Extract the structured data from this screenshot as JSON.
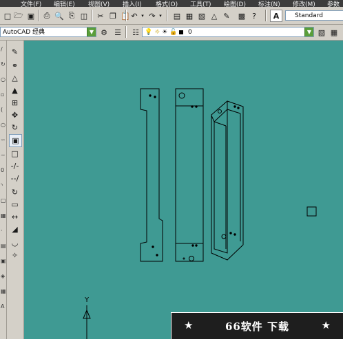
{
  "menu": {
    "items": [
      "文件(F)",
      "编辑(E)",
      "视图(V)",
      "插入(I)",
      "格式(O)",
      "工具(T)",
      "绘图(D)",
      "标注(N)",
      "修改(M)",
      "参数"
    ]
  },
  "toolbar": {
    "text_style_value": "Standard"
  },
  "workspace": {
    "value": "AutoCAD 经典"
  },
  "layer": {
    "current_value": "0"
  },
  "ucs": {
    "y_label": "Y"
  },
  "watermark": {
    "star_left": "★",
    "text": "66软件 下载",
    "star_right": "★"
  },
  "colors": {
    "canvas": "#3f9a93",
    "accent_green": "#5a9e3a"
  },
  "icons": {
    "standard_toolbar": [
      "new-icon",
      "open-icon",
      "save-icon",
      "print-icon",
      "preview-icon",
      "publish-icon",
      "plot-icon",
      "cut-icon",
      "copy-icon",
      "paste-icon",
      "undo-icon",
      "redo-icon",
      "properties-icon",
      "design-center-icon",
      "tool-palette-icon",
      "sheet-set-icon",
      "markup-icon",
      "calculator-icon",
      "text-style-icon"
    ],
    "modify_toolbar": [
      "erase-icon",
      "copy-object-icon",
      "mirror-icon",
      "offset-icon",
      "array-icon",
      "move-icon",
      "rotate-icon",
      "scale-icon",
      "stretch-icon",
      "trim-icon",
      "extend-icon",
      "break-at-point-icon",
      "break-icon",
      "join-icon",
      "chamfer-icon",
      "fillet-icon",
      "explode-icon"
    ]
  }
}
